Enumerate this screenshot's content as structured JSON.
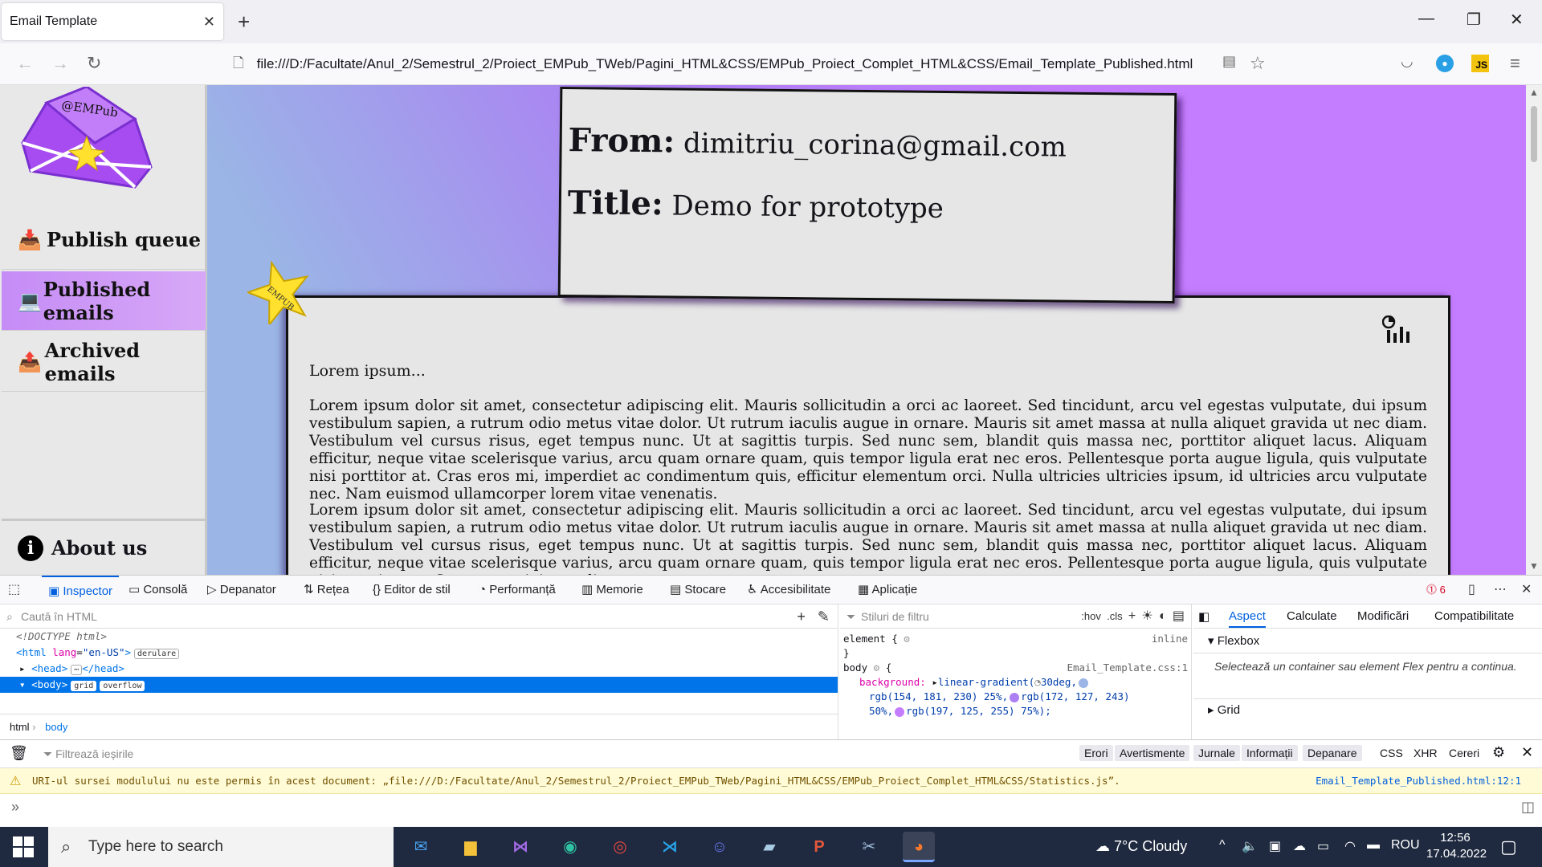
{
  "browser": {
    "tab_title": "Email Template",
    "tab_close": "✕",
    "new_tab": "+",
    "url": "file:///D:/Facultate/Anul_2/Semestrul_2/Proiect_EMPub_TWeb/Pagini_HTML&CSS/EMPub_Proiect_Complet_HTML&CSS/Email_Template_Published.html",
    "ext_js_label": "JS"
  },
  "sidebar": {
    "logo_text": "@EMPub",
    "items": [
      {
        "label": "Publish queue",
        "icon": "inbox-download-icon"
      },
      {
        "label": "Published emails",
        "icon": "laptop-check-icon"
      },
      {
        "label": "Archived emails",
        "icon": "archive-upload-icon"
      }
    ],
    "about_label": "About us",
    "about_icon": "i"
  },
  "email": {
    "from_label": "From:",
    "from_value": "dimitriu_corina@gmail.com",
    "title_label": "Title:",
    "title_value": "Demo for prototype",
    "star_letters": "EMPUB",
    "intro": "Lorem ipsum...",
    "paragraph_1": "Lorem ipsum dolor sit amet, consectetur adipiscing elit. Mauris sollicitudin a orci ac laoreet. Sed tincidunt, arcu vel egestas vulputate, dui ipsum vestibulum sapien, a rutrum odio metus vitae dolor. Ut rutrum iaculis augue in ornare. Mauris sit amet massa at nulla aliquet gravida ut nec diam. Vestibulum vel cursus risus, eget tempus nunc. Ut at sagittis turpis. Sed nunc sem, blandit quis massa nec, porttitor aliquet lacus. Aliquam efficitur, neque vitae scelerisque varius, arcu quam ornare quam, quis tempor ligula erat nec eros. Pellentesque porta augue ligula, quis vulputate nisi porttitor at. Cras eros mi, imperdiet ac condimentum quis, efficitur elementum orci. Nulla ultricies ultricies ipsum, id ultricies arcu vulputate nec. Nam euismod ullamcorper lorem vitae venenatis.",
    "paragraph_2": "Lorem ipsum dolor sit amet, consectetur adipiscing elit. Mauris sollicitudin a orci ac laoreet. Sed tincidunt, arcu vel egestas vulputate, dui ipsum vestibulum sapien, a rutrum odio metus vitae dolor. Ut rutrum iaculis augue in ornare. Mauris sit amet massa at nulla aliquet gravida ut nec diam. Vestibulum vel cursus risus, eget tempus nunc. Ut at sagittis turpis. Sed nunc sem, blandit quis massa nec, porttitor aliquet lacus. Aliquam efficitur, neque vitae scelerisque varius, arcu quam ornare quam, quis tempor ligula erat nec eros. Pellentesque porta augue ligula, quis vulputate nisi porttitor at. Cras eros mi, imperdiet ac"
  },
  "devtools": {
    "tabs": [
      "Inspector",
      "Consolă",
      "Depanator",
      "Rețea",
      "Editor de stil",
      "Performanță",
      "Memorie",
      "Stocare",
      "Accesibilitate",
      "Aplicație"
    ],
    "error_count": "6",
    "html_search_placeholder": "Caută în HTML",
    "html_lines": {
      "doctype": "<!DOCTYPE html>",
      "html_open_tag": "<html",
      "html_attr": "lang",
      "html_attr_val": "\"en-US\"",
      "html_badge": "derulare",
      "head": "<head>",
      "head_close": "</head>",
      "body": "<body>",
      "body_badge_1": "grid",
      "body_badge_2": "overflow"
    },
    "breadcrumb": [
      "html",
      "body"
    ],
    "rules_filter_placeholder": "Stiluri de filtru",
    "rules_tools": [
      ":hov",
      ".cls"
    ],
    "rules": {
      "element_selector": "element {",
      "element_close": "}",
      "element_source": "inline",
      "body_selector": "body",
      "body_open": "{",
      "body_source": "Email_Template.css:1",
      "prop": "background:",
      "value_line_1": "linear-gradient(",
      "angle": "30deg,",
      "value_line_2a": "rgb(154, 181, 230) 25%,",
      "value_line_2b": "rgb(172, 127, 243)",
      "value_line_3a": "50%,",
      "value_line_3b": "rgb(197, 125, 255) 75%);",
      "colors": [
        "#9ab5e6",
        "#ac7ff3",
        "#c57dff"
      ]
    },
    "layout_tabs": [
      "Aspect",
      "Calculate",
      "Modificări",
      "Compatibilitate"
    ],
    "flexbox_title": "Flexbox",
    "flexbox_message": "Selectează un container sau element Flex pentru a continua.",
    "grid_title": "Grid",
    "console_filter_placeholder": "Filtrează ieșirile",
    "console_levels": [
      "Erori",
      "Avertismente",
      "Jurnale",
      "Informații",
      "Depanare"
    ],
    "console_types": [
      "CSS",
      "XHR",
      "Cereri"
    ],
    "warning_text": "URI-ul sursei modulului nu este permis în acest document: „file:///D:/Facultate/Anul_2/Semestrul_2/Proiect_EMPub_TWeb/Pagini_HTML&CSS/EMPub_Proiect_Complet_HTML&CSS/Statistics.js”.",
    "warning_source": "Email_Template_Published.html:12:1",
    "prompt": "»"
  },
  "taskbar": {
    "search_placeholder": "Type here to search",
    "weather": "7°C  Cloudy",
    "language": "ROU",
    "time": "12:56",
    "date": "17.04.2022"
  }
}
